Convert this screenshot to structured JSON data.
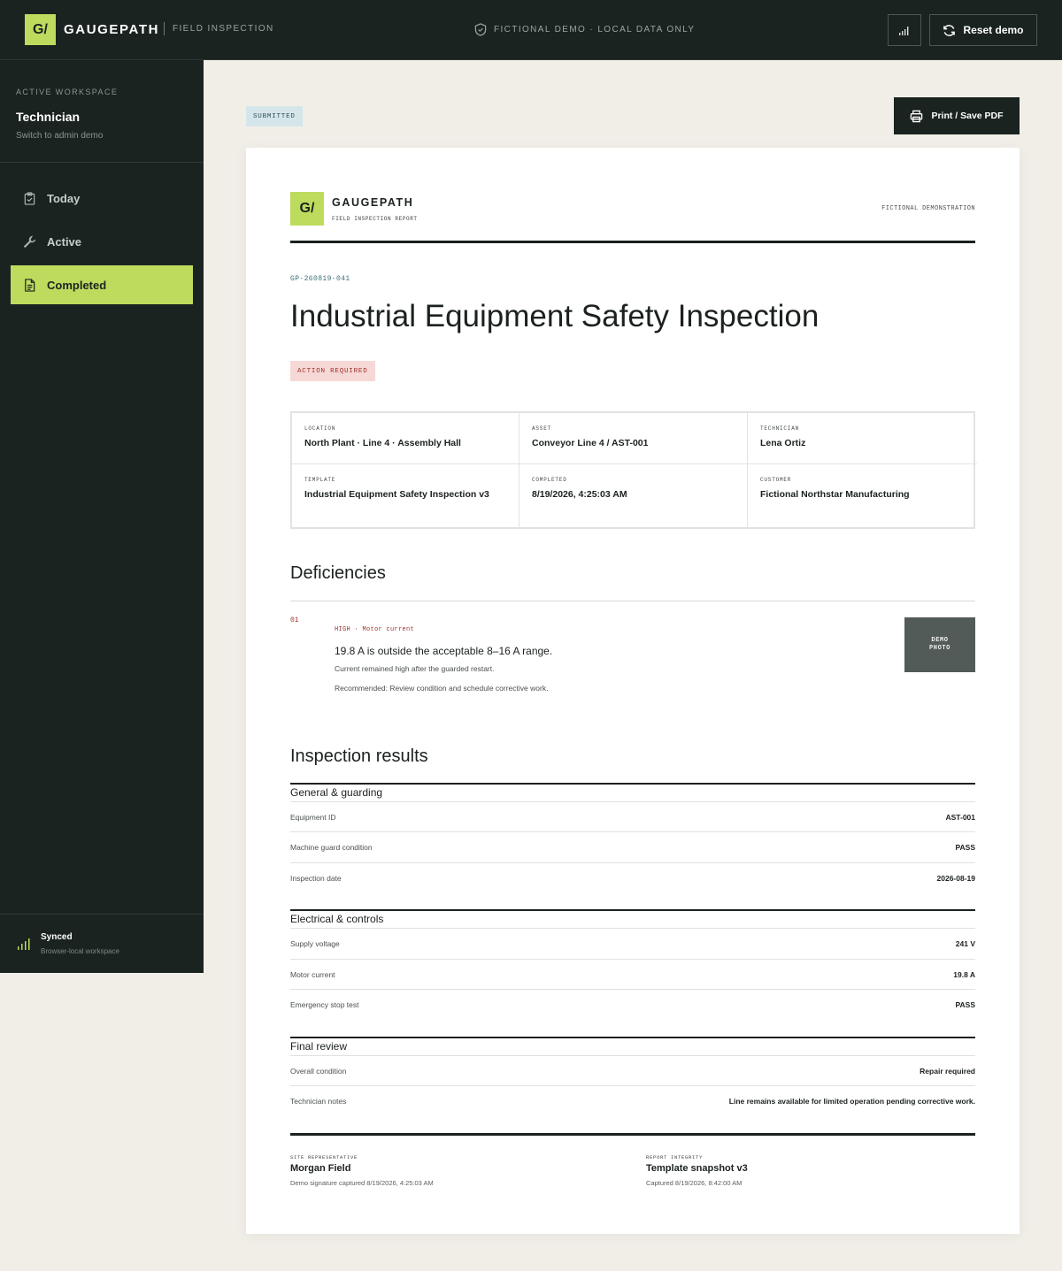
{
  "app": {
    "logo": "G/",
    "brand": "GAUGEPATH",
    "subtitle": "FIELD INSPECTION",
    "demo_note": "FICTIONAL DEMO · LOCAL DATA ONLY",
    "reset_label": "Reset demo"
  },
  "sidebar": {
    "workspace_label": "ACTIVE WORKSPACE",
    "workspace_name": "Technician",
    "switch_label": "Switch to admin demo",
    "items": [
      {
        "label": "Today",
        "icon": "clipboard-check-icon"
      },
      {
        "label": "Active",
        "icon": "wrench-icon"
      },
      {
        "label": "Completed",
        "icon": "document-icon",
        "active": true
      }
    ],
    "sync_title": "Synced",
    "sync_sub": "Browser-local workspace"
  },
  "toolbar": {
    "status": "SUBMITTED",
    "print_label": "Print / Save PDF"
  },
  "report": {
    "logo": "G/",
    "brand": "GAUGEPATH",
    "brand_sub": "FIELD INSPECTION REPORT",
    "fictional": "FICTIONAL DEMONSTRATION",
    "id": "GP-260819-041",
    "title": "Industrial Equipment Safety Inspection",
    "flag": "ACTION REQUIRED",
    "info": [
      {
        "label": "LOCATION",
        "value": "North Plant · Line 4 · Assembly Hall"
      },
      {
        "label": "ASSET",
        "value": "Conveyor Line 4 / AST-001"
      },
      {
        "label": "TECHNICIAN",
        "value": "Lena Ortiz"
      },
      {
        "label": "TEMPLATE",
        "value": "Industrial Equipment Safety Inspection v3"
      },
      {
        "label": "COMPLETED",
        "value": "8/19/2026, 4:25:03 AM"
      },
      {
        "label": "CUSTOMER",
        "value": "Fictional Northstar Manufacturing"
      }
    ],
    "deficiencies_heading": "Deficiencies",
    "deficiency": {
      "number": "01",
      "meta": "HIGH · Motor current",
      "title": "19.8 A is outside the acceptable 8–16 A range.",
      "note": "Current remained high after the guarded restart.",
      "recommendation": "Recommended: Review condition and schedule corrective work.",
      "photo_label": "DEMO\nPHOTO"
    },
    "results_heading": "Inspection results",
    "groups": [
      {
        "title": "General & guarding",
        "rows": [
          {
            "label": "Equipment ID",
            "value": "AST-001"
          },
          {
            "label": "Machine guard condition",
            "value": "PASS"
          },
          {
            "label": "Inspection date",
            "value": "2026-08-19"
          }
        ]
      },
      {
        "title": "Electrical & controls",
        "rows": [
          {
            "label": "Supply voltage",
            "value": "241 V"
          },
          {
            "label": "Motor current",
            "value": "19.8 A"
          },
          {
            "label": "Emergency stop test",
            "value": "PASS"
          }
        ]
      },
      {
        "title": "Final review",
        "rows": [
          {
            "label": "Overall condition",
            "value": "Repair required"
          },
          {
            "label": "Technician notes",
            "value": "Line remains available for limited operation pending corrective work."
          }
        ]
      }
    ],
    "signoff": [
      {
        "label": "SITE REPRESENTATIVE",
        "value": "Morgan Field",
        "sub": "Demo signature captured 8/19/2026, 4:25:03 AM"
      },
      {
        "label": "REPORT INTEGRITY",
        "value": "Template snapshot v3",
        "sub": "Captured 8/19/2026, 8:42:00 AM"
      }
    ]
  },
  "colors": {
    "accent": "#bddb5d",
    "dark": "#1a2320",
    "danger": "#9a2f2a",
    "paper": "#f1eee8"
  }
}
